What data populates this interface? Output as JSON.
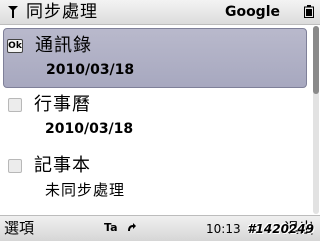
{
  "header": {
    "title": "同步處理",
    "sync_target": "Google",
    "signal_icon": "antenna-icon",
    "battery_icon": "battery-icon"
  },
  "items": [
    {
      "label": "通訊錄",
      "detail": "2010/03/18",
      "checked": true,
      "selected": true
    },
    {
      "label": "行事曆",
      "detail": "2010/03/18",
      "checked": false,
      "selected": false
    },
    {
      "label": "記事本",
      "detail": "未同步處理",
      "checked": false,
      "selected": false
    }
  ],
  "checkbox_checked_text": "Ok",
  "footer": {
    "left_softkey": "選項",
    "input_indicator": "Ta",
    "clock": "10:13",
    "right_softkey": "退出",
    "watermark": "#1420249"
  },
  "colors": {
    "selection": "#adaec4",
    "bar": "#e6e6e6"
  }
}
